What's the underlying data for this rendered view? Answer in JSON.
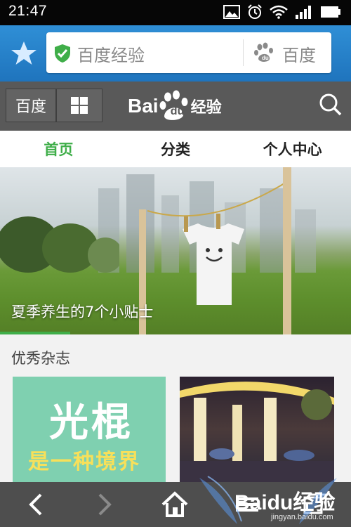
{
  "status_bar": {
    "time": "21:47"
  },
  "browser": {
    "url_text": "百度经验",
    "search_engine": "百度"
  },
  "site_header": {
    "home_label": "百度",
    "logo_bai": "Bai",
    "logo_du": "du",
    "logo_suffix": "经验"
  },
  "tabs": [
    {
      "label": "首页",
      "active": true
    },
    {
      "label": "分类",
      "active": false
    },
    {
      "label": "个人中心",
      "active": false
    }
  ],
  "banner": {
    "caption": "夏季养生的7个小贴士"
  },
  "magazines": {
    "section_title": "优秀杂志",
    "items": [
      {
        "line1": "光棍",
        "line2": "是一种境界"
      }
    ]
  },
  "watermark": {
    "text": "Baidu经验",
    "url": "jingyan.baidu.com"
  },
  "colors": {
    "accent_green": "#3fae49",
    "browser_blue": "#1f74bd",
    "header_gray": "#595959",
    "bottom_bar": "#4e4e4e"
  }
}
